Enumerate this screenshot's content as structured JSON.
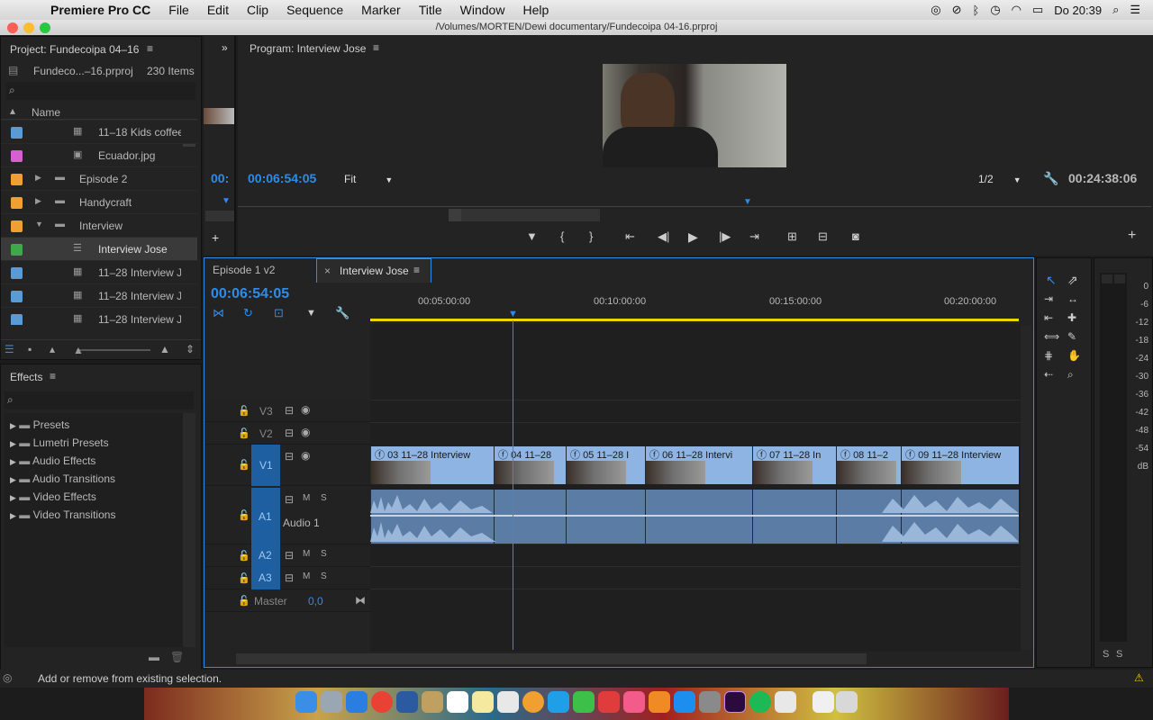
{
  "menubar": {
    "app": "Premiere Pro CC",
    "items": [
      "File",
      "Edit",
      "Clip",
      "Sequence",
      "Marker",
      "Title",
      "Window",
      "Help"
    ],
    "clock": "Do 20:39"
  },
  "window": {
    "title": "/Volumes/MORTEN/Dewi documentary/Fundecoipa 04-16.prproj"
  },
  "project": {
    "title": "Project: Fundecoipa 04–16",
    "file": "Fundeco...–16.prproj",
    "count": "230 Items",
    "column": "Name",
    "items": [
      {
        "name": "11–18 Kids coffee",
        "color": "#5b9bd5",
        "type": "sequence"
      },
      {
        "name": "Ecuador.jpg",
        "color": "#d85fd0",
        "type": "image"
      },
      {
        "name": "Episode 2",
        "color": "#f0a030",
        "type": "folder"
      },
      {
        "name": "Handycraft",
        "color": "#f0a030",
        "type": "folder"
      },
      {
        "name": "Interview",
        "color": "#f0a030",
        "type": "folder"
      },
      {
        "name": "Interview Jose",
        "color": "#3fa84a",
        "type": "sequence"
      },
      {
        "name": "11–28 Interview J",
        "color": "#5b9bd5",
        "type": "clip"
      },
      {
        "name": "11–28 Interview J",
        "color": "#5b9bd5",
        "type": "clip"
      },
      {
        "name": "11–28 Interview J",
        "color": "#5b9bd5",
        "type": "clip"
      }
    ]
  },
  "effects": {
    "title": "Effects",
    "items": [
      "Presets",
      "Lumetri Presets",
      "Audio Effects",
      "Audio Transitions",
      "Video Effects",
      "Video Transitions"
    ]
  },
  "source": {
    "timecode_partial": "00:"
  },
  "program": {
    "title": "Program: Interview Jose",
    "timecode": "00:06:54:05",
    "fit": "Fit",
    "resolution": "1/2",
    "duration": "00:24:38:06"
  },
  "timeline": {
    "tabs": [
      "Episode 1 v2",
      "Interview Jose"
    ],
    "timecode": "00:06:54:05",
    "ruler": [
      "00:05:00:00",
      "00:10:00:00",
      "00:15:00:00",
      "00:20:00:00"
    ],
    "tracks": {
      "v3": "V3",
      "v2": "V2",
      "v1": "V1",
      "a1": "A1",
      "a1_name": "Audio 1",
      "a2": "A2",
      "a3": "A3",
      "master": "Master",
      "master_value": "0,0"
    },
    "clips": [
      "03 11–28 Interview",
      "04 11–28",
      "05 11–28 I",
      "06 11–28 Intervi",
      "07 11–28 In",
      "08 11–2",
      "09 11–28 Interview"
    ]
  },
  "meter": {
    "scale": [
      "0",
      "-6",
      "-12",
      "-18",
      "-24",
      "-30",
      "-36",
      "-42",
      "-48",
      "-54",
      "dB"
    ],
    "solo_l": "S",
    "solo_r": "S"
  },
  "status": {
    "text": "Add or remove from existing selection."
  }
}
